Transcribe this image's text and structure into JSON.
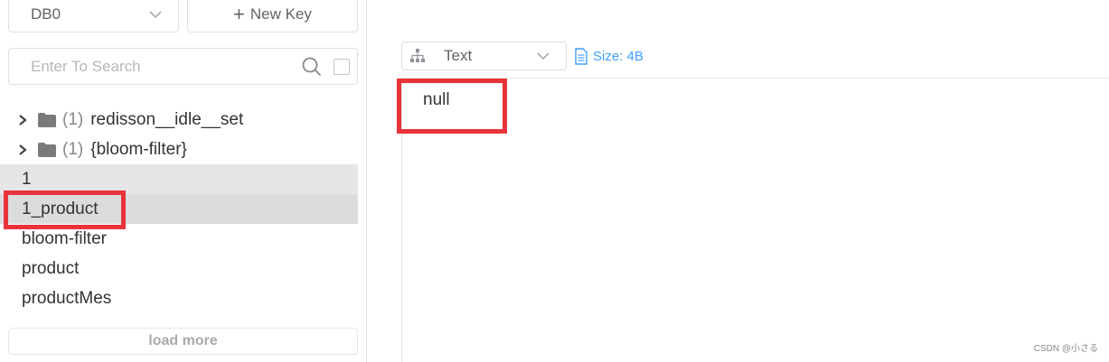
{
  "sidebar": {
    "db_select": "DB0",
    "new_key_label": "New Key",
    "search_placeholder": "Enter To Search",
    "folders": [
      {
        "count": "(1)",
        "name": "redisson__idle__set"
      },
      {
        "count": "(1)",
        "name": "{bloom-filter}"
      }
    ],
    "keys": [
      "1",
      "1_product",
      "bloom-filter",
      "product",
      "productMes"
    ],
    "load_more": "load more"
  },
  "viewer": {
    "format": "Text",
    "size": "Size: 4B",
    "value": "null"
  },
  "watermark": "CSDN @小さる",
  "colors": {
    "highlight": "#e8333a",
    "accent": "#409eff"
  }
}
